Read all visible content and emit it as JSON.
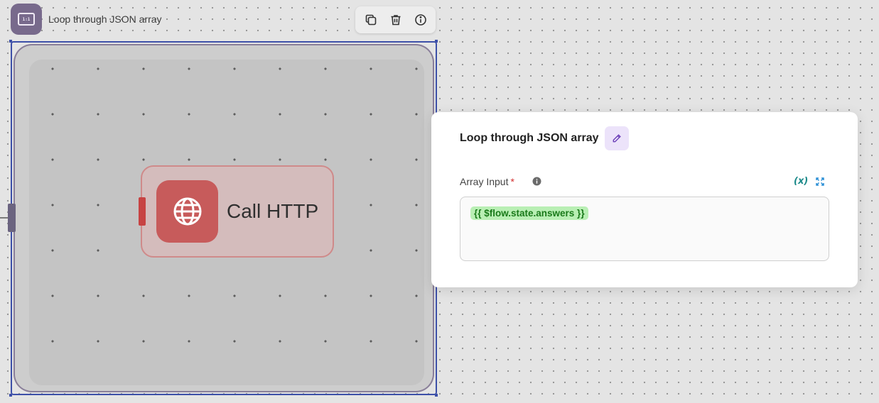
{
  "node": {
    "title": "Loop through JSON array",
    "icon_name": "loop-icon",
    "icon_color": "#786a8c",
    "toolbar": [
      {
        "name": "duplicate-icon"
      },
      {
        "name": "delete-icon"
      },
      {
        "name": "info-icon"
      }
    ]
  },
  "child_node": {
    "label": "Call HTTP",
    "icon_name": "globe-icon",
    "color": "#c75b5b"
  },
  "dialog": {
    "title": "Loop through JSON array",
    "field": {
      "label": "Array Input",
      "required_mark": "*",
      "var_button": "(x)",
      "value": "{{ $flow.state.answers }}"
    }
  },
  "colors": {
    "selection": "#3d50a8",
    "accent_teal": "#1c8a8a",
    "chip_bg": "#b9efb4"
  }
}
